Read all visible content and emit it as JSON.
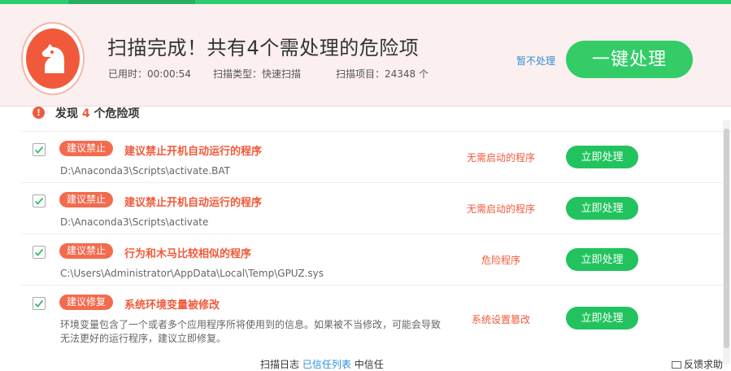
{
  "header": {
    "title": "扫描完成！共有4个需处理的危险项",
    "elapsed": "已用时：00:00:54",
    "scan_type": "扫描类型：快速扫描",
    "scan_items": "扫描项目：24348 个",
    "later_label": "暂不处理",
    "onekey_label": "一键处理"
  },
  "summary": {
    "prefix": "发现 ",
    "count": "4",
    "suffix": " 个危险项"
  },
  "items": [
    {
      "tag": "建议禁止",
      "title": "建议禁止开机自动运行的程序",
      "detail": "D:\\Anaconda3\\Scripts\\activate.BAT",
      "status": "无需启动的程序",
      "action": "立即处理"
    },
    {
      "tag": "建议禁止",
      "title": "建议禁止开机自动运行的程序",
      "detail": "D:\\Anaconda3\\Scripts\\activate",
      "status": "无需启动的程序",
      "action": "立即处理"
    },
    {
      "tag": "建议禁止",
      "title": "行为和木马比较相似的程序",
      "detail": "C:\\Users\\Administrator\\AppData\\Local\\Temp\\GPUZ.sys",
      "status": "危险程序",
      "action": "立即处理"
    },
    {
      "tag": "建议修复",
      "title": "系统环境变量被修改",
      "detail": "环境变量包含了一个或者多个应用程序所将使用到的信息。如果被不当修改，可能会导致无法更好的运行程序，建议立即修复。",
      "status": "系统设置篡改",
      "action": "立即处理"
    }
  ],
  "footer": {
    "left": "扫描日志",
    "link": "已信任列表",
    "right": "中信任"
  },
  "feedback_label": "反馈求助",
  "colors": {
    "accent_green": "#22c35e",
    "danger_red": "#f05a3a",
    "header_bg": "#fbefef",
    "link_blue": "#2f8fd6"
  }
}
